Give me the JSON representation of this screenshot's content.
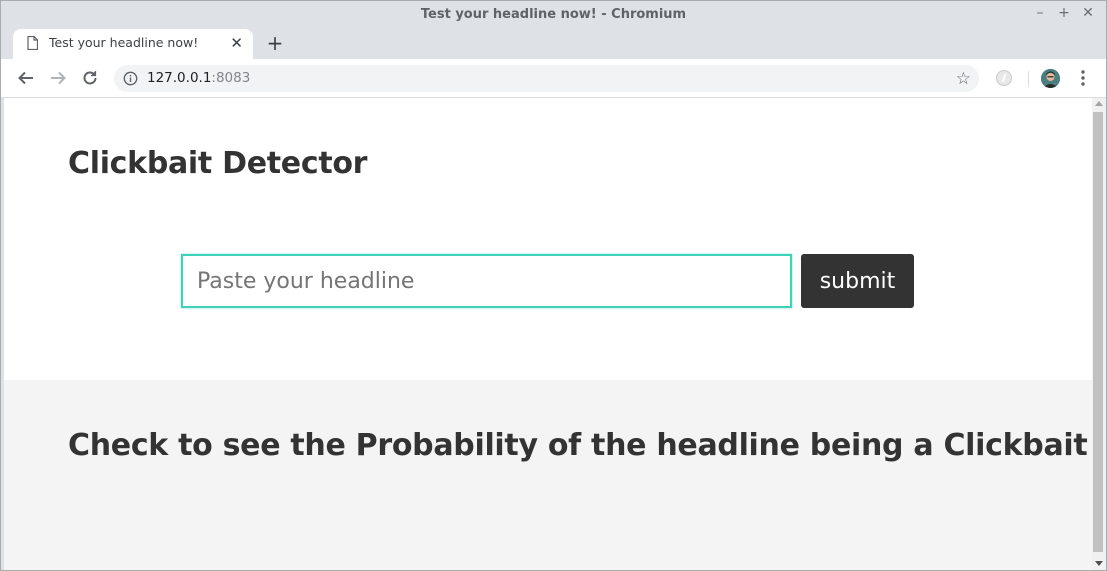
{
  "window": {
    "title": "Test your headline now! - Chromium",
    "controls": [
      "–",
      "+",
      "✕"
    ]
  },
  "tab": {
    "title": "Test your headline now!",
    "close_glyph": "✕",
    "favicon": "document-icon"
  },
  "newtab": {
    "glyph": "+"
  },
  "toolbar": {
    "url_host": "127.0.0.1",
    "url_port": ":8083",
    "star_glyph": "☆",
    "icons": [
      "back-arrow-icon",
      "forward-arrow-icon",
      "reload-icon",
      "info-icon",
      "bookmark-star-icon",
      "extension-icon",
      "profile-avatar",
      "kebab-menu-icon"
    ]
  },
  "page": {
    "title": "Clickbait Detector",
    "input_placeholder": "Paste your headline",
    "input_value": "",
    "submit_label": "submit",
    "result_heading": "Check to see the Probability of the headline being a Clickbait"
  },
  "colors": {
    "input_border": "#3fd1b9",
    "button_bg": "#333333",
    "result_bg": "#f4f4f4",
    "text": "#333333"
  }
}
